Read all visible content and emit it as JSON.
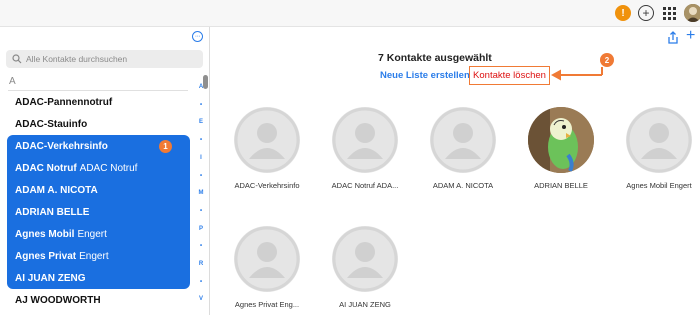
{
  "topbar": {
    "alert_badge": "!",
    "add_label": "+",
    "icons": [
      "alert-icon",
      "add-circle-icon",
      "apps-grid-icon",
      "user-avatar"
    ]
  },
  "sidebar": {
    "more_glyph": "···",
    "search_placeholder": "Alle Kontakte durchsuchen",
    "section_letter": "A",
    "contacts": [
      {
        "first": "ADAC-Pannennotruf",
        "rest": "",
        "selected": false
      },
      {
        "first": "ADAC-Stauinfo",
        "rest": "",
        "selected": false
      },
      {
        "first": "ADAC-Verkehrsinfo",
        "rest": "",
        "selected": true,
        "badge": "1"
      },
      {
        "first": "ADAC Notruf",
        "rest": "ADAC Notruf",
        "selected": true
      },
      {
        "first": "ADAM A. NICOTA",
        "rest": "",
        "selected": true
      },
      {
        "first": "ADRIAN BELLE",
        "rest": "",
        "selected": true
      },
      {
        "first": "Agnes Mobil",
        "rest": "Engert",
        "selected": true
      },
      {
        "first": "Agnes Privat",
        "rest": "Engert",
        "selected": true
      },
      {
        "first": "AI JUAN ZENG",
        "rest": "",
        "selected": true
      },
      {
        "first": "AJ WOODWORTH",
        "rest": "",
        "selected": false
      }
    ],
    "alpha_index": [
      "A",
      "•",
      "E",
      "•",
      "I",
      "•",
      "M",
      "•",
      "P",
      "•",
      "R",
      "•",
      "V"
    ]
  },
  "main": {
    "summary": "7 Kontakte ausgewählt",
    "new_list_label": "Neue Liste erstellen",
    "delete_label": "Kontakte löschen",
    "step_badge": "2",
    "accent_color": "#f07a35",
    "selection_color": "#1a6fe0",
    "cards": [
      {
        "name": "ADAC-Verkehrsinfo",
        "photo": false
      },
      {
        "name": "ADAC Notruf ADA...",
        "photo": false
      },
      {
        "name": "ADAM A. NICOTA",
        "photo": false
      },
      {
        "name": "ADRIAN BELLE",
        "photo": true
      },
      {
        "name": "Agnes Mobil Engert",
        "photo": false
      },
      {
        "name": "Agnes Privat Eng...",
        "photo": false
      },
      {
        "name": "AI JUAN ZENG",
        "photo": false
      }
    ]
  }
}
